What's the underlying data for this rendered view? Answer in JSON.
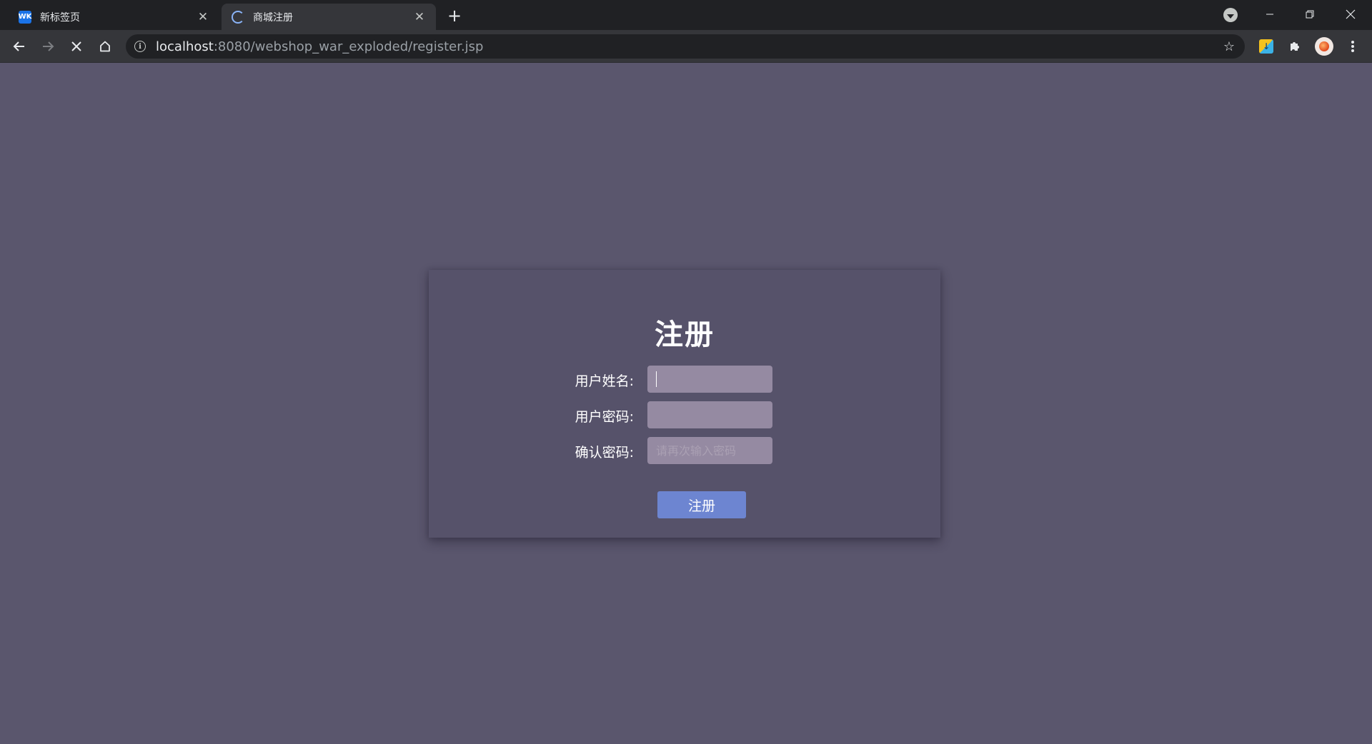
{
  "browser": {
    "tabs": [
      {
        "title": "新标签页",
        "active": false,
        "icon": "wk-icon"
      },
      {
        "title": "商城注册",
        "active": true,
        "icon": "loading-spinner-icon"
      }
    ],
    "new_tab_symbol": "+",
    "close_symbol": "✕",
    "url": {
      "host": "localhost",
      "rest": ":8080/webshop_war_exploded/register.jsp"
    },
    "favicon_text": "WK",
    "colors": {
      "titlebar": "#202124",
      "toolbar": "#35363a",
      "omnibox": "#202124"
    }
  },
  "page": {
    "heading": "注册",
    "fields": {
      "username": {
        "label": "用户姓名:",
        "value": "",
        "placeholder": ""
      },
      "password": {
        "label": "用户密码:",
        "value": "",
        "placeholder": ""
      },
      "confirm": {
        "label": "确认密码:",
        "value": "",
        "placeholder": "请再次输入密码"
      }
    },
    "submit_label": "注册",
    "colors": {
      "background": "#5a566d",
      "card": "#56526a",
      "input": "#958aa2",
      "button": "#6d85d1"
    }
  }
}
